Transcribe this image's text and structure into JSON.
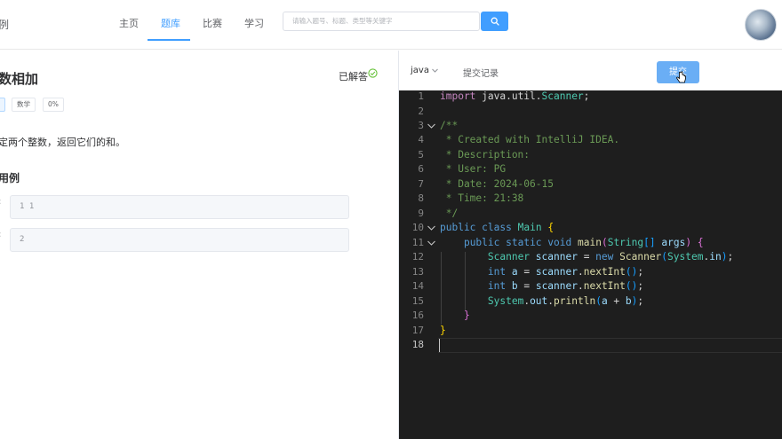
{
  "header": {
    "brand": "例",
    "nav": [
      "主页",
      "题库",
      "比赛",
      "学习"
    ],
    "active_nav": "题库",
    "search_placeholder": "请输入题号、标题、类型等关键字"
  },
  "question": {
    "title": "数相加",
    "status": "已解答",
    "tags": [
      "数学",
      "0%"
    ],
    "description": "定两个整数，返回它们的和。",
    "case_title": "用例",
    "cases": [
      {
        "label": ":",
        "value": "1 1"
      },
      {
        "label": ":",
        "value": "2"
      }
    ]
  },
  "editor_toolbar": {
    "language": "java",
    "record_label": "提交记录",
    "submit_label": "提交"
  },
  "code_lines": [
    "import java.util.Scanner;",
    "",
    "/**",
    " * Created with IntelliJ IDEA.",
    " * Description:",
    " * User: PG",
    " * Date: 2024-06-15",
    " * Time: 21:38",
    " */",
    "public class Main {",
    "    public static void main(String[] args) {",
    "        Scanner scanner = new Scanner(System.in);",
    "        int a = scanner.nextInt();",
    "        int b = scanner.nextInt();",
    "        System.out.println(a + b);",
    "    }",
    "}",
    ""
  ],
  "line_numbers": [
    "1",
    "2",
    "3",
    "4",
    "5",
    "6",
    "7",
    "8",
    "9",
    "10",
    "11",
    "12",
    "13",
    "14",
    "15",
    "16",
    "17",
    "18"
  ],
  "colors": {
    "accent": "#409eff",
    "editor_bg": "#1e1e1e",
    "solved_check": "#67c23a"
  },
  "icons": [
    "search-icon",
    "check-circle-icon",
    "chevron-down-icon",
    "fold-chevron-icon",
    "pointer-cursor-icon"
  ]
}
